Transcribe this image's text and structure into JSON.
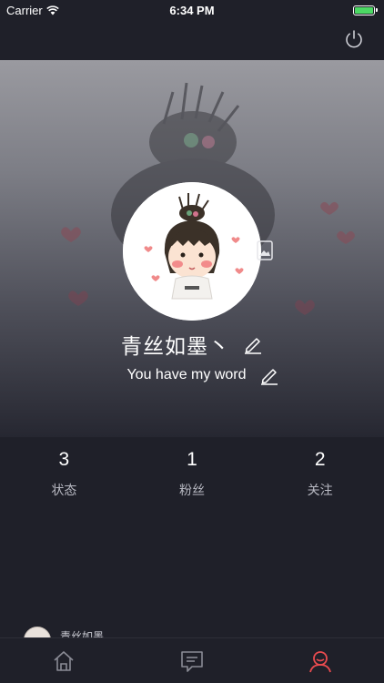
{
  "status_bar": {
    "carrier": "Carrier",
    "time": "6:34 PM"
  },
  "profile": {
    "username": "青丝如墨丶",
    "bio": "You have my word"
  },
  "stats": [
    {
      "count": "3",
      "label": "状态"
    },
    {
      "count": "1",
      "label": "粉丝"
    },
    {
      "count": "2",
      "label": "关注"
    }
  ],
  "peek_item": {
    "name": "青丝如墨"
  },
  "tabbar": {
    "tabs": [
      {
        "icon": "home-icon",
        "active": false
      },
      {
        "icon": "message-icon",
        "active": false
      },
      {
        "icon": "profile-icon",
        "active": true
      }
    ],
    "active_color": "#e94b4f",
    "inactive_color": "#8a8b95"
  },
  "colors": {
    "background": "#1f2029",
    "battery": "#4cd964",
    "accent": "#e94b4f"
  }
}
